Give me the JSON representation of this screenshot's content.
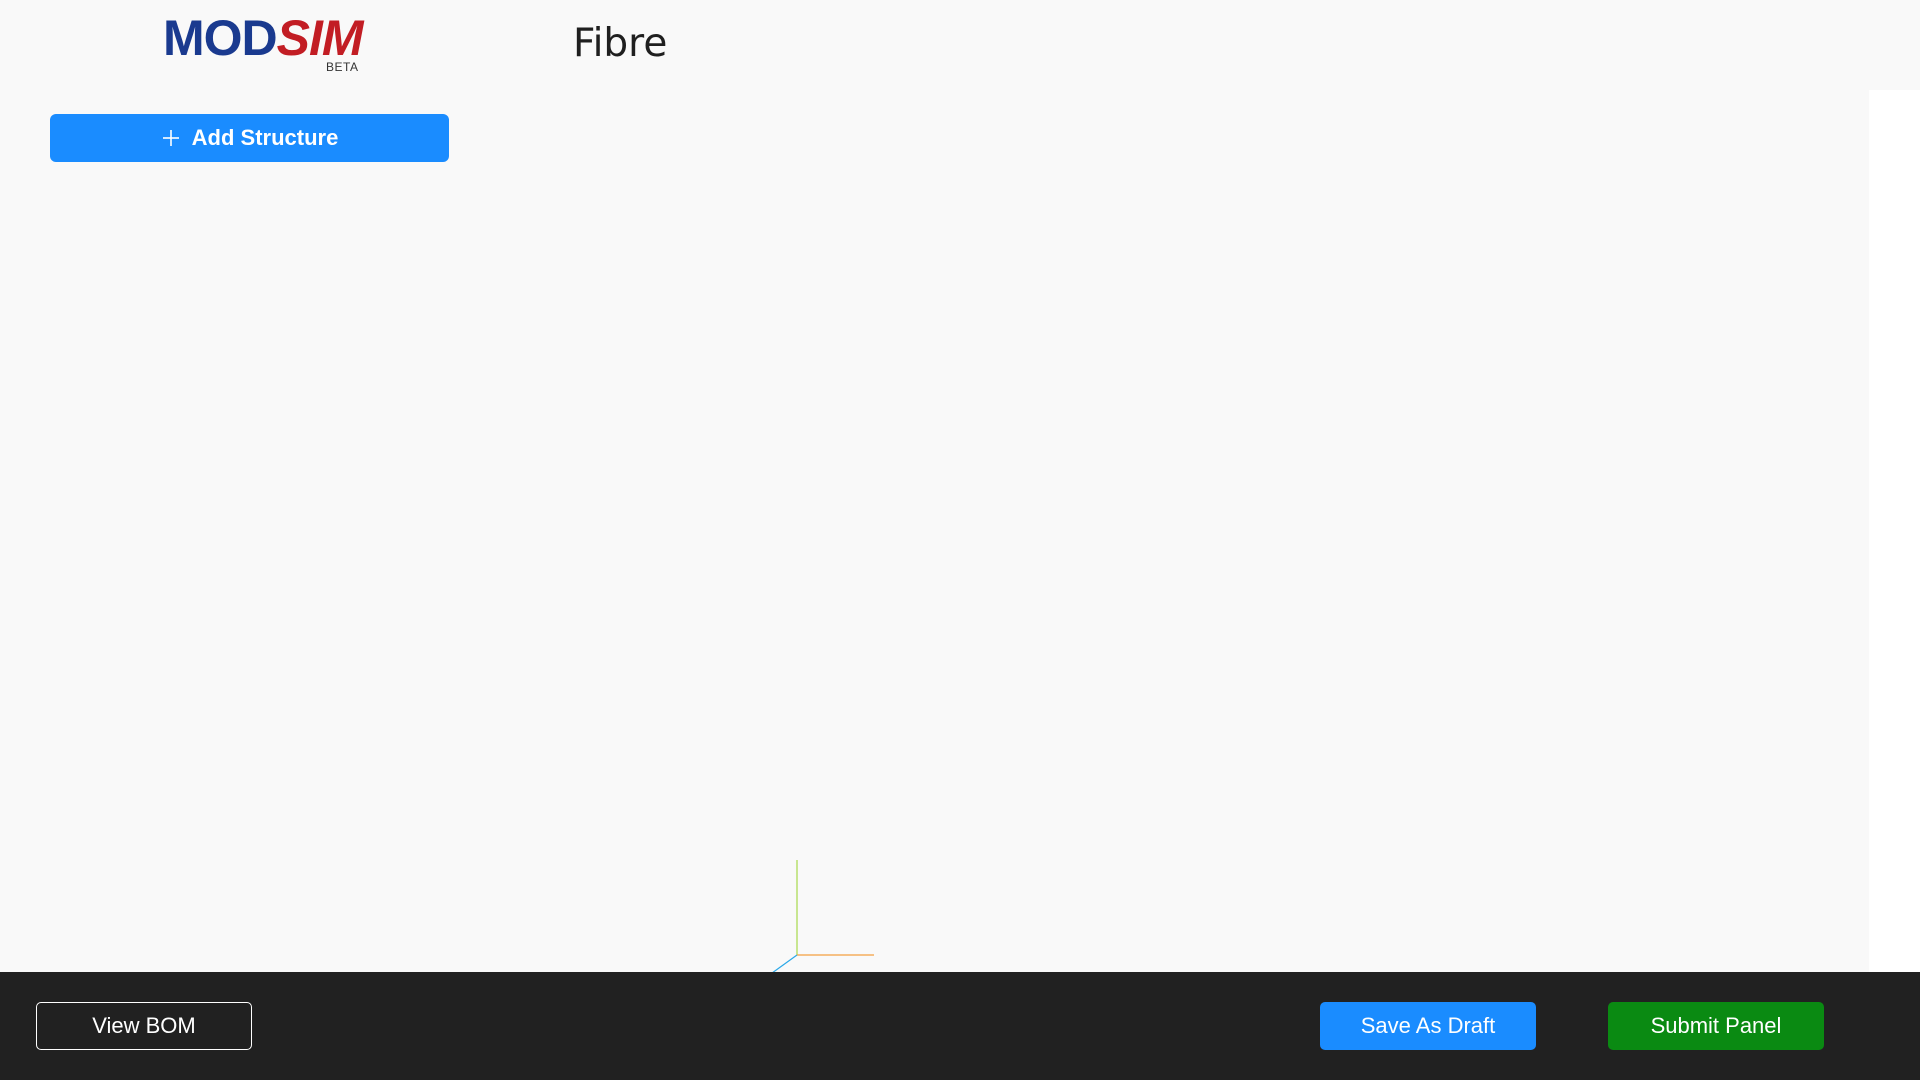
{
  "logo": {
    "mod": "MOD",
    "sim": "SIM",
    "beta": "BETA"
  },
  "header": {
    "title": "Fibre"
  },
  "sidebar": {
    "add_structure_label": "Add Structure",
    "add_icon": "plus-icon"
  },
  "viewport": {
    "axes_gizmo": {
      "x_axis_color": "#f5a040",
      "y_axis_color": "#a8d84a",
      "z_axis_color": "#2aa8e8"
    }
  },
  "footer": {
    "view_bom_label": "View BOM",
    "save_draft_label": "Save As Draft",
    "submit_panel_label": "Submit Panel"
  },
  "colors": {
    "brand_blue": "#1a3a8f",
    "brand_red": "#c21d24",
    "primary": "#1a8cff",
    "success": "#0a8a12",
    "footer_bg": "#212121"
  }
}
